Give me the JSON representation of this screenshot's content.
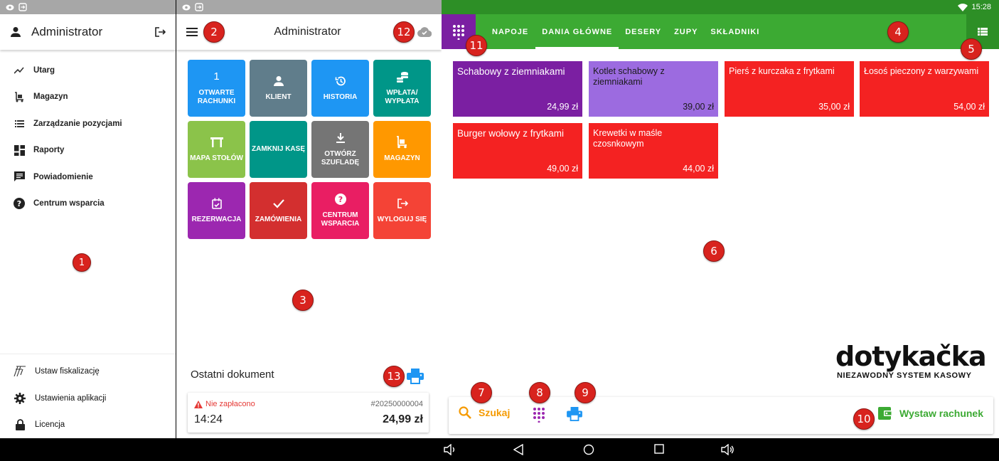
{
  "drawer": {
    "title": "Administrator",
    "items": [
      {
        "label": "Utarg",
        "icon": "trending-up-icon"
      },
      {
        "label": "Magazyn",
        "icon": "warehouse-icon"
      },
      {
        "label": "Zarządzanie pozycjami",
        "icon": "list-icon"
      },
      {
        "label": "Raporty",
        "icon": "dashboard-icon"
      },
      {
        "label": "Powiadomienie",
        "icon": "message-icon"
      },
      {
        "label": "Centrum wsparcia",
        "icon": "help-icon"
      }
    ],
    "bottom_items": [
      {
        "label": "Ustaw fiskalizację",
        "icon": "fiscal-icon"
      },
      {
        "label": "Ustawienia aplikacji",
        "icon": "gear-icon"
      },
      {
        "label": "Licencja",
        "icon": "lock-icon"
      }
    ]
  },
  "center": {
    "title": "Administrator",
    "tiles": [
      {
        "label": "Otwarte rachunki",
        "icon_text": "1",
        "color": "#1e96f3"
      },
      {
        "label": "Klient",
        "icon": "person-icon",
        "color": "#607d8b"
      },
      {
        "label": "Historia",
        "icon": "history-icon",
        "color": "#1e96f3"
      },
      {
        "label": "Wpłata/ wypłata",
        "icon": "coins-icon",
        "color": "#009688"
      },
      {
        "label": "Mapa stołów",
        "icon": "table-icon",
        "color": "#8bc34a"
      },
      {
        "label": "Zamknij kasę",
        "icon": "",
        "color": "#009688"
      },
      {
        "label": "Otwórz szufladę",
        "icon": "download-icon",
        "color": "#757575"
      },
      {
        "label": "Magazyn",
        "icon": "forklift-icon",
        "color": "#ff9800"
      },
      {
        "label": "Rezerwacja",
        "icon": "calendar-icon",
        "color": "#9c27b0"
      },
      {
        "label": "Zamówienia",
        "icon": "check-icon",
        "color": "#d32f2f"
      },
      {
        "label": "Centrum wsparcia",
        "icon": "help-icon",
        "color": "#e91e63"
      },
      {
        "label": "Wyloguj się",
        "icon": "logout-icon",
        "color": "#f44336"
      }
    ],
    "last_doc_title": "Ostatni dokument",
    "doc": {
      "status": "Nie zapłacono",
      "number": "#20250000004",
      "time": "14:24",
      "amount": "24,99 zł"
    }
  },
  "pos": {
    "clock": "15:28",
    "tabs": [
      "NAPOJE",
      "DANIA GŁÓWNE",
      "DESERY",
      "ZUPY",
      "SKŁADNIKI"
    ],
    "active_tab": "DANIA GŁÓWNE",
    "products": [
      {
        "name": "Schabowy z ziemniakami",
        "price": "24,99 zł",
        "color": "#7b1fa2"
      },
      {
        "name": "Kotlet schabowy z ziemniakami",
        "price": "39,00 zł",
        "color": "#9c6be0"
      },
      {
        "name": "Pierś z kurczaka z frytkami",
        "price": "35,00 zł",
        "color": "#f42222"
      },
      {
        "name": "Łosoś pieczony z warzywami",
        "price": "54,00 zł",
        "color": "#f42222"
      },
      {
        "name": "Burger wołowy z frytkami",
        "price": "49,00 zł",
        "color": "#f42222"
      },
      {
        "name": "Krewetki w maśle czosnkowym",
        "price": "44,00 zł",
        "color": "#f42222"
      }
    ],
    "logo_brand": "dotykačka",
    "logo_tagline": "NIEZAWODNY SYSTEM KASOWY",
    "search_label": "Szukaj",
    "bill_label": "Wystaw rachunek"
  },
  "badges": [
    "1",
    "2",
    "3",
    "4",
    "5",
    "6",
    "7",
    "8",
    "9",
    "10",
    "11",
    "12",
    "13"
  ],
  "colors": {
    "green": "#3caa33",
    "purple": "#7b1fa2",
    "red": "#f42222",
    "orange": "#f59a00",
    "blue": "#1e96f3"
  }
}
